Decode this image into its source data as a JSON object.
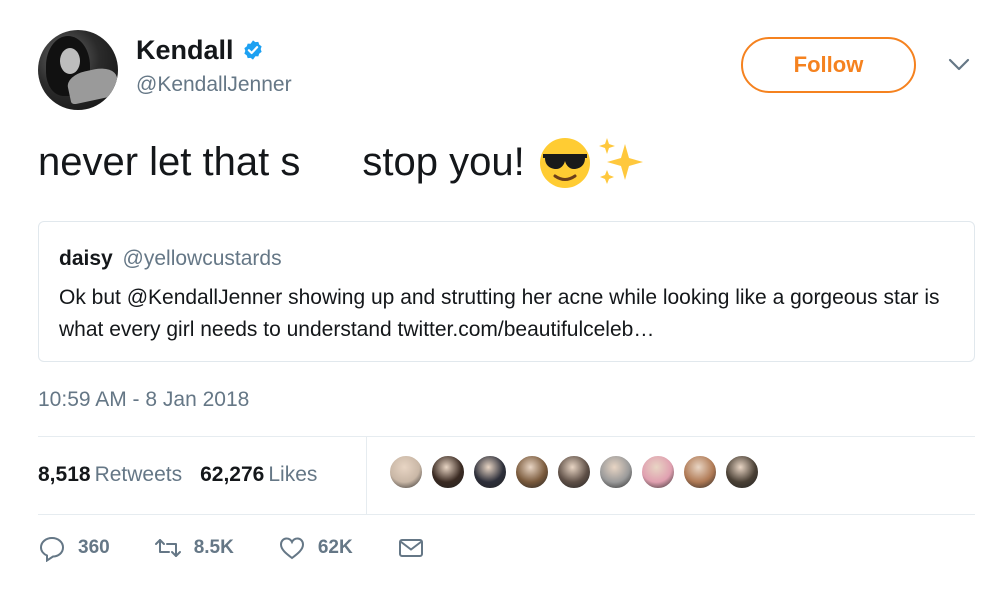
{
  "author": {
    "display_name": "Kendall",
    "handle": "@KendallJenner",
    "verified": true
  },
  "follow_button": {
    "label": "Follow"
  },
  "tweet": {
    "text_before": "never let that s",
    "text_after": "stop you!",
    "emojis": [
      "sunglasses-emoji",
      "sparkles-emoji"
    ]
  },
  "quoted_tweet": {
    "name": "daisy",
    "handle": "@yellowcustards",
    "body": "Ok but @KendallJenner showing up and strutting her acne while looking like a gorgeous star is what every girl needs to understand twitter.com/beautifulceleb…"
  },
  "timestamp": "10:59 AM - 8 Jan 2018",
  "stats": {
    "retweets_count": "8,518",
    "retweets_label": "Retweets",
    "likes_count": "62,276",
    "likes_label": "Likes"
  },
  "likers": [
    {
      "name": "liker-avatar-1",
      "color": "#c9b7a6"
    },
    {
      "name": "liker-avatar-2",
      "color": "#3a2a22"
    },
    {
      "name": "liker-avatar-3",
      "color": "#2d2f3a"
    },
    {
      "name": "liker-avatar-4",
      "color": "#7a5a3c"
    },
    {
      "name": "liker-avatar-5",
      "color": "#5f5047"
    },
    {
      "name": "liker-avatar-6",
      "color": "#9a9a9a"
    },
    {
      "name": "liker-avatar-7",
      "color": "#e0a0b0"
    },
    {
      "name": "liker-avatar-8",
      "color": "#b07a55"
    },
    {
      "name": "liker-avatar-9",
      "color": "#4a4035"
    }
  ],
  "actions": {
    "reply_count": "360",
    "retweet_count": "8.5K",
    "like_count": "62K"
  },
  "colors": {
    "accent_orange": "#f5821f",
    "secondary_text": "#657786",
    "verified_blue": "#1da1f2",
    "border": "#e1e8ed"
  }
}
